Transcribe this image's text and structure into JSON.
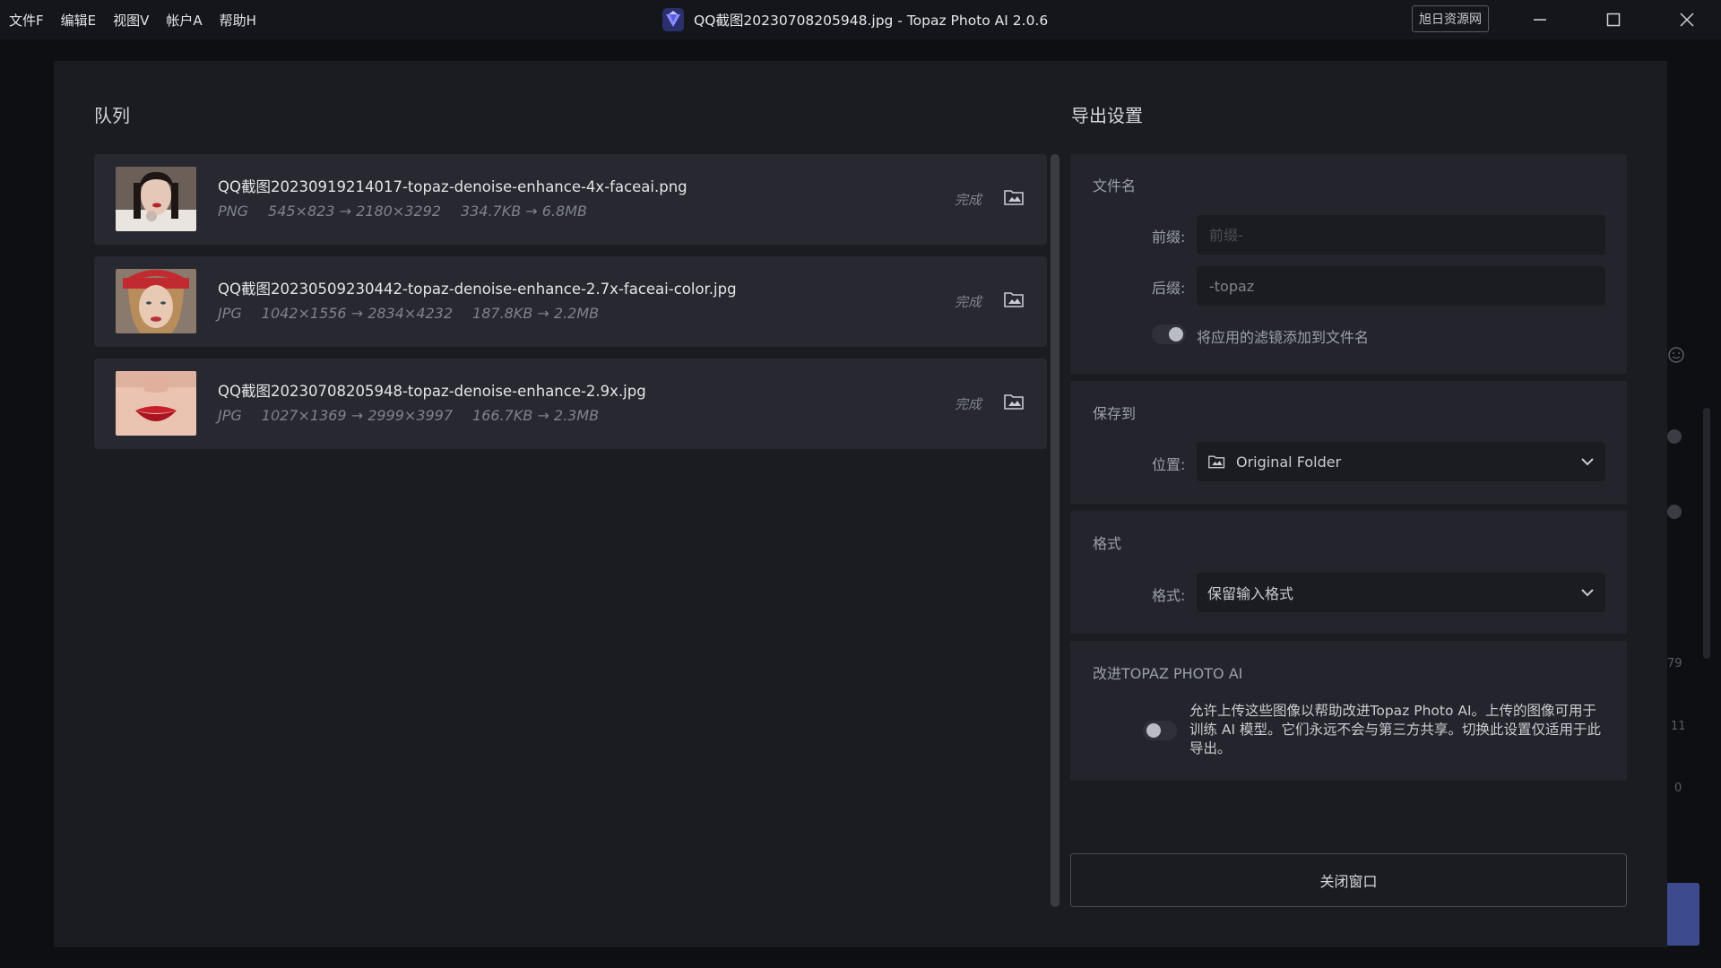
{
  "menu": [
    "文件F",
    "编辑E",
    "视图V",
    "帐户A",
    "帮助H"
  ],
  "window": {
    "title": "QQ截图20230708205948.jpg - Topaz Photo AI 2.0.6",
    "badge": "旭日资源网",
    "minimize_icon": "minimize-icon",
    "maximize_icon": "maximize-icon",
    "close_icon": "close-icon"
  },
  "background_app": {
    "numbers": [
      "79",
      "11",
      "0"
    ]
  },
  "queue": {
    "title": "队列",
    "items": [
      {
        "filename": "QQ截图20230919214017-topaz-denoise-enhance-4x-faceai.png",
        "format": "PNG",
        "dimensions": "545×823 → 2180×3292",
        "size": "334.7KB → 6.8MB",
        "status": "完成",
        "icon": "open-folder-icon"
      },
      {
        "filename": "QQ截图20230509230442-topaz-denoise-enhance-2.7x-faceai-color.jpg",
        "format": "JPG",
        "dimensions": "1042×1556 → 2834×4232",
        "size": "187.8KB → 2.2MB",
        "status": "完成",
        "icon": "open-folder-icon"
      },
      {
        "filename": "QQ截图20230708205948-topaz-denoise-enhance-2.9x.jpg",
        "format": "JPG",
        "dimensions": "1027×1369 → 2999×3997",
        "size": "166.7KB → 2.3MB",
        "status": "完成",
        "icon": "open-folder-icon"
      }
    ]
  },
  "export": {
    "title": "导出设置",
    "filename_section": {
      "heading": "文件名",
      "prefix_label": "前缀:",
      "prefix_placeholder": "前缀-",
      "prefix_value": "",
      "suffix_label": "后缀:",
      "suffix_value": "-topaz",
      "append_filters_label": "将应用的滤镜添加到文件名",
      "append_filters_on": false
    },
    "save_section": {
      "heading": "保存到",
      "location_label": "位置:",
      "location_value": "Original Folder"
    },
    "format_section": {
      "heading": "格式",
      "format_label": "格式:",
      "format_value": "保留输入格式"
    },
    "improve_section": {
      "heading": "改进TOPAZ PHOTO AI",
      "description": "允许上传这些图像以帮助改进Topaz Photo AI。上传的图像可用于训练 AI 模型。它们永远不会与第三方共享。切换此设置仅适用于此导出。",
      "enabled": false
    },
    "close_button": "关闭窗口"
  },
  "colors": {
    "accent": "#3d4b8e",
    "panel": "#24252c",
    "card": "#272830"
  }
}
